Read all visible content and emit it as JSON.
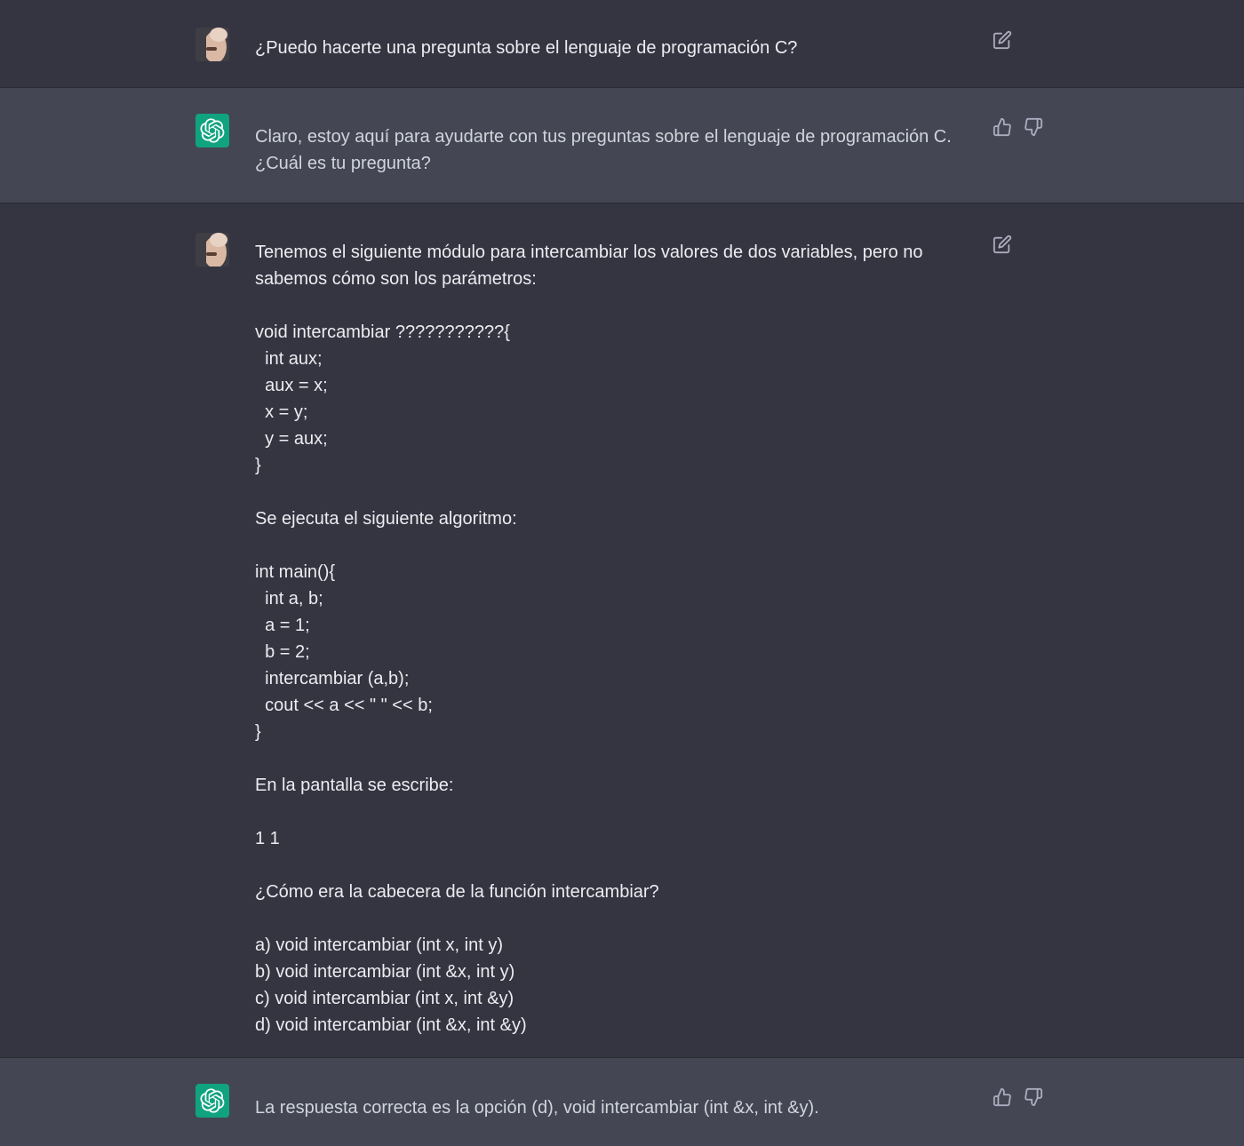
{
  "conversation": {
    "messages": [
      {
        "role": "user",
        "avatar_icon": "user-avatar",
        "text": "¿Puedo hacerte una pregunta sobre el lenguaje de programación C?",
        "action_icons": [
          "edit-icon"
        ]
      },
      {
        "role": "assistant",
        "avatar_icon": "chatgpt-logo-icon",
        "text": "Claro, estoy aquí para ayudarte con tus preguntas sobre el lenguaje de programación C. ¿Cuál es tu pregunta?",
        "action_icons": [
          "thumbs-up-icon",
          "thumbs-down-icon"
        ]
      },
      {
        "role": "user",
        "avatar_icon": "user-avatar",
        "text": "Tenemos el siguiente módulo para intercambiar los valores de dos variables, pero no sabemos cómo son los parámetros:\n\nvoid intercambiar ???????????{\n  int aux;\n  aux = x;\n  x = y;\n  y = aux;\n}\n\nSe ejecuta el siguiente algoritmo:\n\nint main(){\n  int a, b;\n  a = 1;\n  b = 2;\n  intercambiar (a,b);\n  cout << a << \" \" << b;\n}\n\nEn la pantalla se escribe:\n\n1 1\n\n¿Cómo era la cabecera de la función intercambiar?\n\na) void intercambiar (int x, int y)\nb) void intercambiar (int &x, int y)\nc) void intercambiar (int x, int &y)\nd) void intercambiar (int &x, int &y)",
        "action_icons": [
          "edit-icon"
        ]
      },
      {
        "role": "assistant",
        "avatar_icon": "chatgpt-logo-icon",
        "text": "La respuesta correcta es la opción (d), void intercambiar (int &x, int &y).",
        "action_icons": [
          "thumbs-up-icon",
          "thumbs-down-icon"
        ]
      }
    ]
  },
  "colors": {
    "user_row_bg": "#343541",
    "assistant_row_bg": "#444654",
    "chatgpt_brand": "#10a37f",
    "icon_gray": "#acacbe"
  }
}
